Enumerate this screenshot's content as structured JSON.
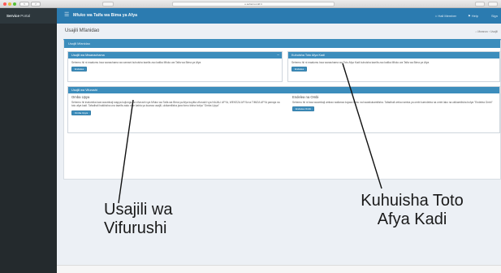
{
  "browser": {
    "url": "e.sehemu.mkf.it",
    "back": "<",
    "forward": ">"
  },
  "header": {
    "brand_strong": "Service",
    "brand_light": "Portal",
    "menu_icon": "hamburger-icon",
    "title": "Mfuko wa Taifa wa Bima ya Afya",
    "user": "⌂ Hall Member",
    "help": "⚑ Help",
    "signout": "Sign"
  },
  "page": {
    "title": "Usajili Mfanidao",
    "breadcrumb": "⌂ Mwanzo › Usajili",
    "section_title": "Usajili Mfanidao",
    "panels": {
      "top_left": {
        "title": "Usajili wa Mwanachama",
        "body": "Sehemu hii ni maalumu kwa wanachama wa zamani kuhuisha taarifa zao katika Mfuko wa Taifa wa Bima ya Afya",
        "button": "Endelea"
      },
      "top_right": {
        "title": "Kuhuisha Toto Afya Kadi",
        "body": "Sehemu hii ni maalumu kwa wanachama wa Toto Afya Kadi kuhuisha taarifa zao katika Mfuko wa Taifa wa Bima ya Afya",
        "button": "Endelea"
      },
      "middle": {
        "title": "Usajili wa Vifurushi",
        "left": {
          "subtitle": "Omba Upya",
          "body": "Sehemu hii inatumika kwa waombaji wapya kujiunga na vifurushi vya Mfuko wa Taifa wa Bima ya Afya kupitia vifurushi vya NAJALI AFYA, WEKEZA AFYA na TIMIZA AFYA pamoja na toto afya kadi. Tafadhali hakikisha una taarifa zako zote kabla ya kuanza usajili, ukikamilisha jaza fomu kisha bofya \"Omba Upya\"",
          "button": "Omba Upya"
        },
        "right": {
          "subtitle": "Endelea na Ombi",
          "body": "Sehemu hii ni kwa waombaji ambao walianza kujaza fomu na hawakukamilisha. Tafadhali weka namba ya ombi kuendelea na ombi lako na ukikamilisha bofya \"Endelea Ombi\"",
          "button": "Endelea Ombi"
        }
      }
    }
  },
  "annotations": {
    "left": [
      "Usajili wa",
      "Vifurushi"
    ],
    "right": [
      "Kuhuisha Toto",
      "Afya Kadi"
    ]
  }
}
